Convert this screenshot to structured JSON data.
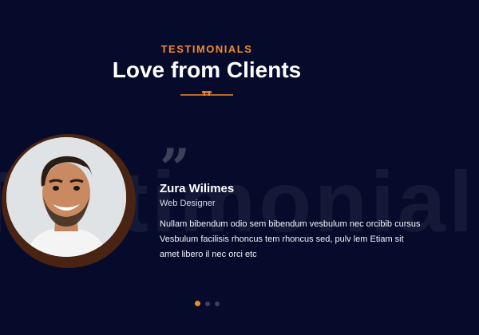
{
  "header": {
    "eyebrow": "TESTIMONIALS",
    "title": "Love from Clients"
  },
  "watermark": "Testimonials",
  "testimonial": {
    "quote_glyph": "”",
    "name": "Zura Wilimes",
    "role": "Web Designer",
    "text": "Nullam bibendum odio sem bibendum vesbulum nec orcibib cursus Vesbulum facilisis rhoncus tem rhoncus sed, pulv lem Etiam sit amet libero il nec orci etc"
  },
  "pagination": {
    "active_index": 0,
    "count": 3
  },
  "colors": {
    "background": "#060b2b",
    "accent": "#f08a2c",
    "photo_ring": "#4a2413"
  }
}
